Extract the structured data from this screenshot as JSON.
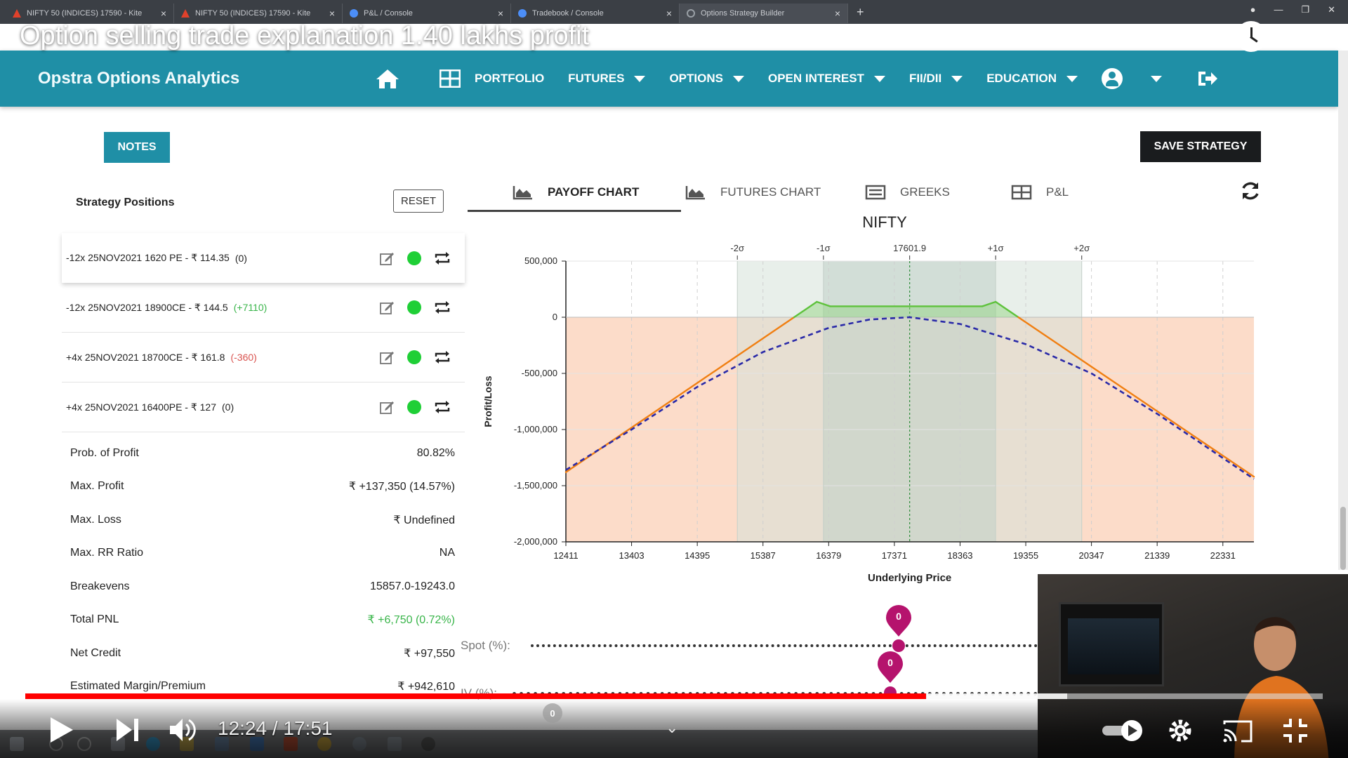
{
  "browser": {
    "tabs": [
      {
        "title": "NIFTY 50 (INDICES) 17590 - Kite",
        "icon": "kite-icon"
      },
      {
        "title": "NIFTY 50 (INDICES) 17590 - Kite",
        "icon": "kite-icon"
      },
      {
        "title": "P&L / Console",
        "icon": "zerodha-icon"
      },
      {
        "title": "Tradebook / Console",
        "icon": "zerodha-icon"
      },
      {
        "title": "Options Strategy Builder",
        "icon": "opstra-icon"
      }
    ],
    "new_tab": "+"
  },
  "video": {
    "title": "Option selling trade explanation 1.40 lakhs profit",
    "time": "12:24 / 17:51",
    "progress_fraction": 0.694
  },
  "nav": {
    "brand": "Opstra Options Analytics",
    "items": [
      "PORTFOLIO",
      "FUTURES",
      "OPTIONS",
      "OPEN INTEREST",
      "FII/DII",
      "EDUCATION"
    ]
  },
  "page": {
    "notes_label": "NOTES",
    "save_label": "SAVE STRATEGY"
  },
  "positions": {
    "title": "Strategy Positions",
    "reset_label": "RESET",
    "rows": [
      {
        "text": "-12x 25NOV2021 1620 PE - ₹ 114.35",
        "pl": "(0)",
        "pl_class": ""
      },
      {
        "text": "-12x 25NOV2021 18900CE - ₹ 144.5",
        "pl": "(+7110)",
        "pl_class": "pos"
      },
      {
        "text": "+4x 25NOV2021 18700CE - ₹ 161.8",
        "pl": "(-360)",
        "pl_class": "neg"
      },
      {
        "text": "+4x 25NOV2021 16400PE - ₹ 127",
        "pl": "(0)",
        "pl_class": ""
      }
    ]
  },
  "stats": [
    {
      "label": "Prob. of Profit",
      "value": "80.82%",
      "green": false
    },
    {
      "label": "Max. Profit",
      "value": "₹ +137,350 (14.57%)",
      "green": false
    },
    {
      "label": "Max. Loss",
      "value": "₹ Undefined",
      "green": false
    },
    {
      "label": "Max. RR Ratio",
      "value": "NA",
      "green": false
    },
    {
      "label": "Breakevens",
      "value": "15857.0-19243.0",
      "green": false
    },
    {
      "label": "Total PNL",
      "value": "₹ +6,750 (0.72%)",
      "green": true
    },
    {
      "label": "Net Credit",
      "value": "₹ +97,550",
      "green": false
    },
    {
      "label": "Estimated Margin/Premium",
      "value": "₹ +942,610",
      "green": false
    }
  ],
  "chart_tabs": [
    {
      "label": "PAYOFF CHART",
      "icon": "area-chart-icon",
      "active": true
    },
    {
      "label": "FUTURES CHART",
      "icon": "area-chart-icon",
      "active": false
    },
    {
      "label": "GREEKS",
      "icon": "list-icon",
      "active": false
    },
    {
      "label": "P&L",
      "icon": "table-icon",
      "active": false
    }
  ],
  "sliders": {
    "spot_label": "Spot (%):",
    "iv_label": "IV (%):",
    "spot_value": "0",
    "iv_value": "0",
    "extra_value": "0"
  },
  "colors": {
    "nav": "#1f8fa6",
    "payoff_line": "#f07f12",
    "profit_line": "#5ec23c",
    "t0_line": "#2a2aa8",
    "loss_fill": "#fbd6c0",
    "pin": "#b5136d"
  },
  "chart_data": {
    "type": "line",
    "title": "NIFTY",
    "xlabel": "Underlying Price",
    "ylabel": "Profit/Loss",
    "x_ticks": [
      12411,
      13403,
      14395,
      15387,
      16379,
      17371,
      18363,
      19355,
      20347,
      21339,
      22331
    ],
    "y_ticks": [
      500000,
      0,
      -500000,
      -1000000,
      -1500000,
      -2000000
    ],
    "y_tick_labels": [
      "500,000",
      "0",
      "-500,000",
      "-1,000,000",
      "-1,500,000",
      "-2,000,000"
    ],
    "xlim": [
      12411,
      22800
    ],
    "ylim": [
      -2000000,
      500000
    ],
    "spot": 17601.9,
    "spot_label": "17601.9",
    "sigma_labels": [
      {
        "label": "-2σ",
        "x": 15000
      },
      {
        "label": "-1σ",
        "x": 16300
      },
      {
        "label": "17601.9",
        "x": 17601.9
      },
      {
        "label": "+1σ",
        "x": 18900
      },
      {
        "label": "+2σ",
        "x": 20200
      }
    ],
    "bands": [
      {
        "from": 15000,
        "to": 20200,
        "level": "2sigma"
      },
      {
        "from": 16300,
        "to": 18900,
        "level": "1sigma"
      }
    ],
    "series": [
      {
        "key": "expiry",
        "x": [
          12411,
          15857,
          16200,
          16400,
          18700,
          18900,
          19243,
          22800
        ],
        "y": [
          -1380000,
          0,
          137350,
          97550,
          97550,
          137350,
          0,
          -1420000
        ]
      },
      {
        "key": "t0",
        "x": [
          12411,
          13403,
          14395,
          15387,
          16379,
          17000,
          17601.9,
          18363,
          19355,
          20347,
          21339,
          22800
        ],
        "y": [
          -1360000,
          -1000000,
          -620000,
          -310000,
          -95000,
          -20000,
          0,
          -60000,
          -240000,
          -500000,
          -860000,
          -1440000
        ]
      }
    ]
  }
}
